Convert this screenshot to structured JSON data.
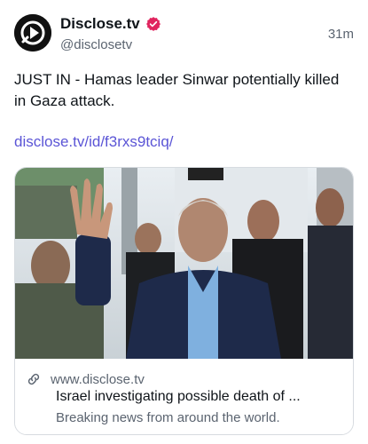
{
  "post": {
    "author_name": "Disclose.tv",
    "author_handle": "@disclosetv",
    "timestamp": "31m",
    "verified_icon": "verified-badge-icon",
    "text": "JUST IN - Hamas leader Sinwar potentially killed in Gaza attack.",
    "link_text": "disclose.tv/id/f3rxs9tciq/"
  },
  "card": {
    "domain": "www.disclose.tv",
    "title": "Israel investigating possible death of ...",
    "description": "Breaking news from around the world.",
    "link_icon": "link-chain-icon"
  },
  "colors": {
    "accent_link": "#5b55d6",
    "verified_badge": "#e0245e",
    "text_primary": "#0f1419",
    "text_secondary": "#5b6470"
  }
}
